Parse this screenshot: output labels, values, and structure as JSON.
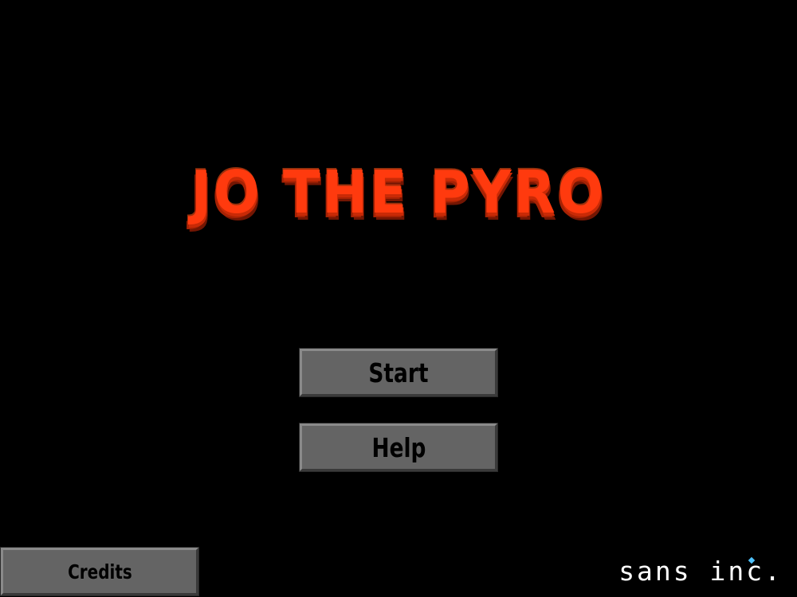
{
  "title": "JO THE PYRO",
  "menu": {
    "start_label": "Start",
    "help_label": "Help",
    "credits_label": "Credits"
  },
  "studio": {
    "name": "sans inc."
  },
  "colors": {
    "background": "#000000",
    "title": "#ff3a0e",
    "button_fill": "#646464",
    "button_text": "#000000",
    "studio_text": "#ffffff",
    "studio_accent": "#4fc3ff"
  }
}
